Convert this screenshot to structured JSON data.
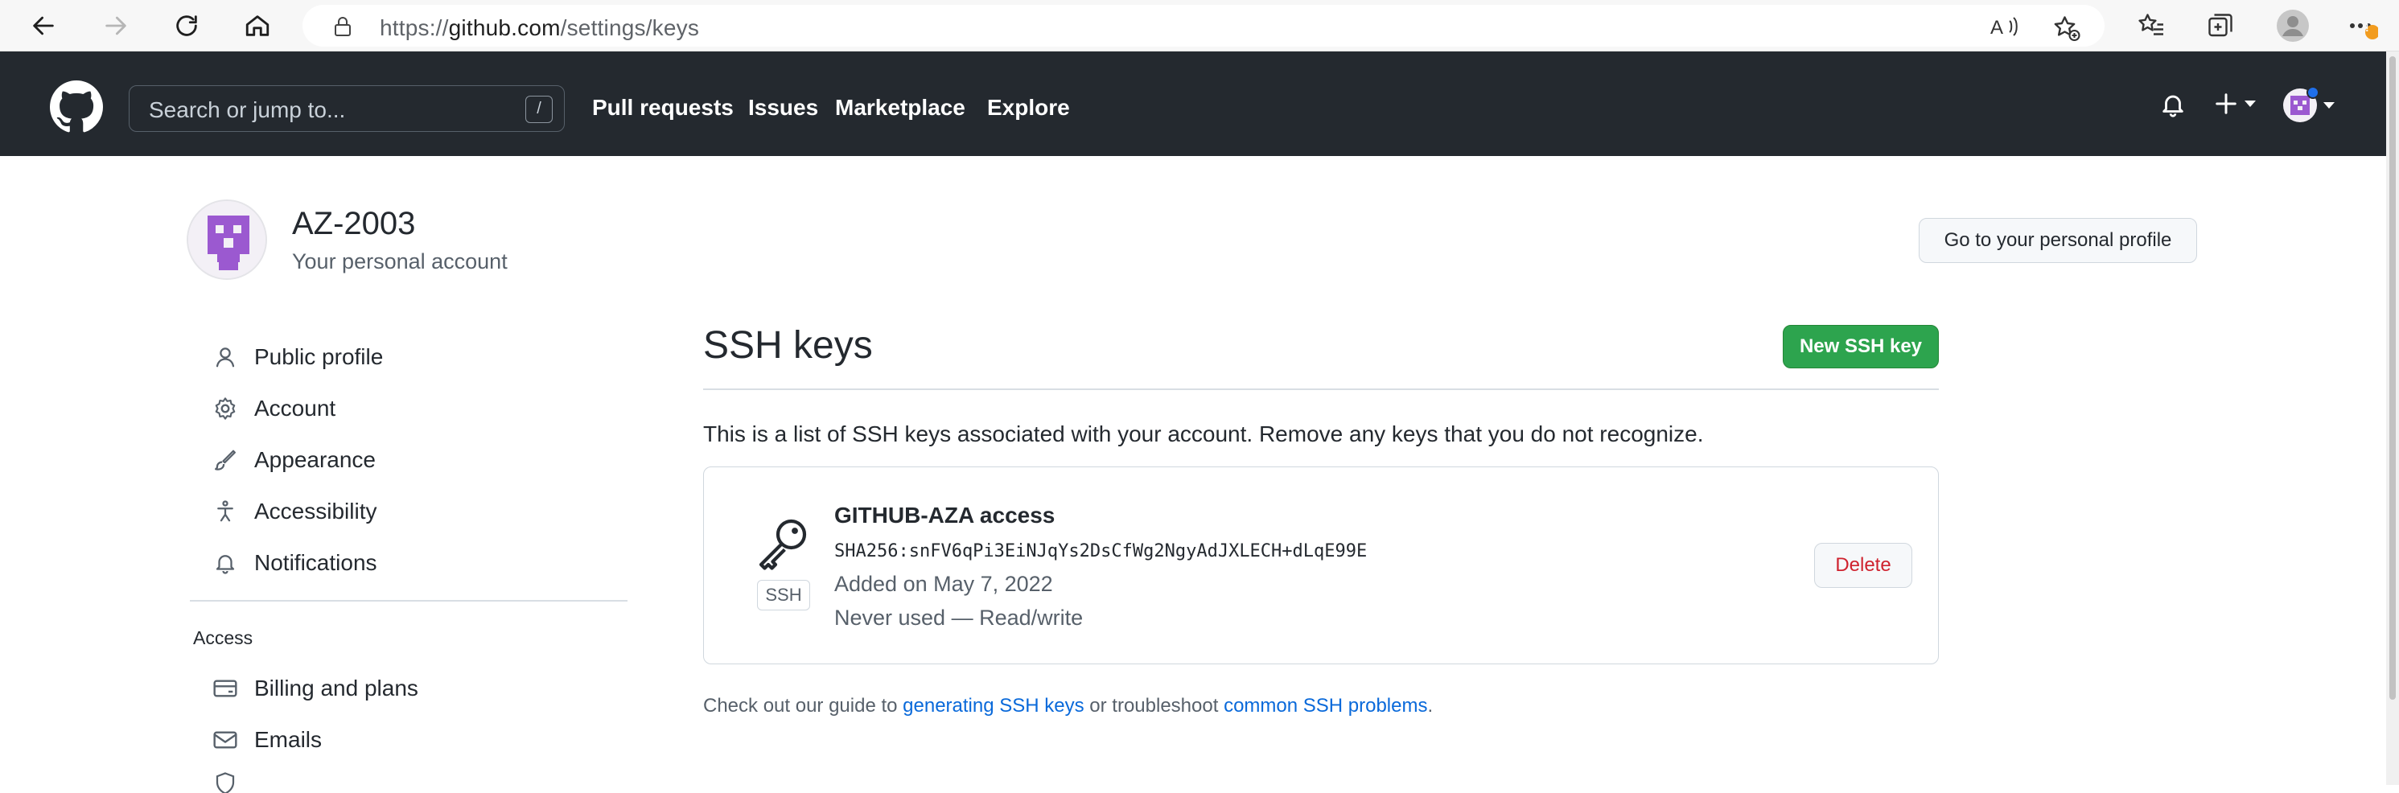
{
  "browser": {
    "url_prefix": "https://",
    "url_host": "github.com",
    "url_path": "/settings/keys",
    "notification_badge": "!"
  },
  "header": {
    "search_placeholder": "Search or jump to...",
    "search_shortcut": "/",
    "nav": [
      "Pull requests",
      "Issues",
      "Marketplace",
      "Explore"
    ]
  },
  "account": {
    "name": "AZ-2003",
    "subtitle": "Your personal account",
    "profile_button": "Go to your personal profile"
  },
  "sidebar": {
    "items": [
      {
        "label": "Public profile",
        "icon": "person-icon"
      },
      {
        "label": "Account",
        "icon": "gear-icon"
      },
      {
        "label": "Appearance",
        "icon": "paintbrush-icon"
      },
      {
        "label": "Accessibility",
        "icon": "accessibility-icon"
      },
      {
        "label": "Notifications",
        "icon": "bell-icon"
      }
    ],
    "access_heading": "Access",
    "access_items": [
      {
        "label": "Billing and plans",
        "icon": "credit-card-icon"
      },
      {
        "label": "Emails",
        "icon": "mail-icon"
      }
    ]
  },
  "main": {
    "title": "SSH keys",
    "new_button": "New SSH key",
    "intro": "This is a list of SSH keys associated with your account. Remove any keys that you do not recognize.",
    "key": {
      "title": "GITHUB-AZA access",
      "fingerprint": "SHA256:snFV6qPi3EiNJqYs2DsCfWg2NgyAdJXLECH+dLqE99E",
      "added": "Added on May 7, 2022",
      "usage": "Never used — Read/write",
      "tag": "SSH",
      "delete_label": "Delete"
    },
    "footer": {
      "pre": "Check out our guide to ",
      "link1": "generating SSH keys",
      "mid": " or troubleshoot ",
      "link2": "common SSH problems",
      "post": "."
    }
  },
  "colors": {
    "header_bg": "#24292f",
    "primary_green": "#2da44e",
    "danger_red": "#cf222e",
    "link_blue": "#0969da"
  }
}
